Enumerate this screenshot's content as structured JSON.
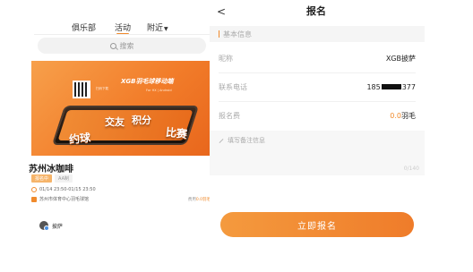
{
  "left_screen": {
    "tabs": [
      {
        "label": "俱乐部",
        "active": false
      },
      {
        "label": "活动",
        "active": true
      },
      {
        "label": "附近",
        "active": false,
        "dropdown": true
      }
    ],
    "search_placeholder": "搜索",
    "banner": {
      "brand": "XGB羽毛球移动端",
      "brand_sub": "For HX | Android",
      "qr_caption": "扫码下载",
      "words": [
        "约球",
        "交友",
        "积分",
        "比赛"
      ]
    },
    "event": {
      "title": "苏州冰咖啡",
      "tags": [
        "报名中",
        "AA制"
      ],
      "time": "01/14 23:50-01/15 23:50",
      "place": "苏州市体育中心羽毛球馆",
      "price_prefix": "费用",
      "price_value": "0.0羽毛",
      "host": "披萨"
    }
  },
  "right_screen": {
    "back_glyph": "<",
    "title": "报名",
    "section_label": "基本信息",
    "fields": [
      {
        "label": "昵称",
        "value": "XGB披萨"
      },
      {
        "label": "联系电话",
        "value_prefix": "185",
        "value_suffix": "377"
      },
      {
        "label": "报名费",
        "value_number": "0.0",
        "value_unit": "羽毛"
      }
    ],
    "note_placeholder": "填写备注信息",
    "note_counter": "0/140",
    "submit_label": "立即报名"
  },
  "colors": {
    "accent": "#f08a2c",
    "button_gradient_start": "#f49a3e",
    "button_gradient_end": "#ef7c2a",
    "label_gray": "#aaaaaa"
  }
}
